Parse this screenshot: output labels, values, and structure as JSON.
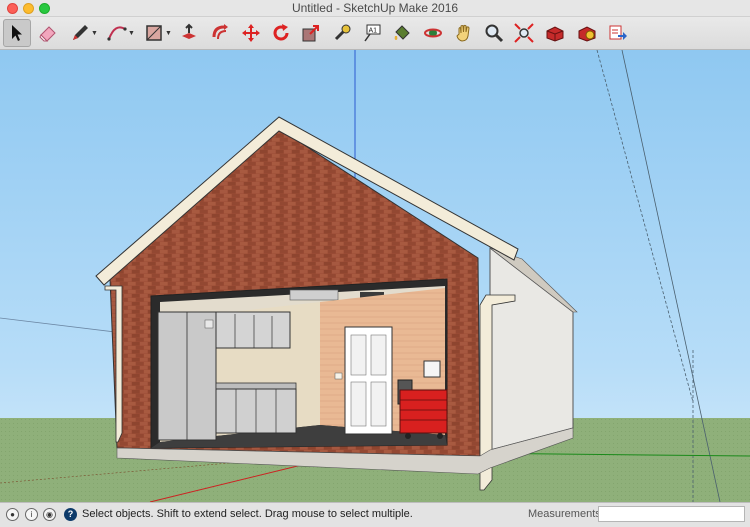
{
  "window": {
    "title": "Untitled - SketchUp Make 2016"
  },
  "toolbar": {
    "tools": [
      {
        "name": "Select",
        "icon": "select-arrow-icon",
        "active": true
      },
      {
        "name": "Eraser",
        "icon": "eraser-icon"
      },
      {
        "name": "Line",
        "icon": "pencil-icon",
        "dropdown": true
      },
      {
        "name": "Arc",
        "icon": "arc-icon",
        "dropdown": true
      },
      {
        "name": "Rectangle",
        "icon": "rectangle-icon",
        "dropdown": true
      },
      {
        "name": "Push/Pull",
        "icon": "push-pull-icon"
      },
      {
        "name": "Offset",
        "icon": "offset-icon"
      },
      {
        "name": "Move",
        "icon": "move-icon"
      },
      {
        "name": "Rotate",
        "icon": "rotate-icon"
      },
      {
        "name": "Scale",
        "icon": "scale-icon"
      },
      {
        "name": "Tape Measure",
        "icon": "tape-measure-icon"
      },
      {
        "name": "Text",
        "icon": "text-icon",
        "glyph": "A1"
      },
      {
        "name": "Paint Bucket",
        "icon": "paint-bucket-icon"
      },
      {
        "name": "Orbit",
        "icon": "orbit-icon"
      },
      {
        "name": "Pan",
        "icon": "pan-hand-icon"
      },
      {
        "name": "Zoom",
        "icon": "zoom-icon"
      },
      {
        "name": "Zoom Extents",
        "icon": "zoom-extents-icon"
      },
      {
        "name": "3D Warehouse",
        "icon": "warehouse-icon"
      },
      {
        "name": "Extension Warehouse",
        "icon": "extension-warehouse-icon"
      },
      {
        "name": "Share Model",
        "icon": "share-model-icon"
      }
    ]
  },
  "colors": {
    "sky": "#9fd0f5",
    "ground": "#8fb07a",
    "brick": "#a2523a",
    "trim": "#f3ecd9",
    "toolbox": "#d8201f"
  },
  "status": {
    "message": "Select objects. Shift to extend select. Drag mouse to select multiple.",
    "help_glyph": "?",
    "measurements_label": "Measurements",
    "measurements_value": ""
  }
}
